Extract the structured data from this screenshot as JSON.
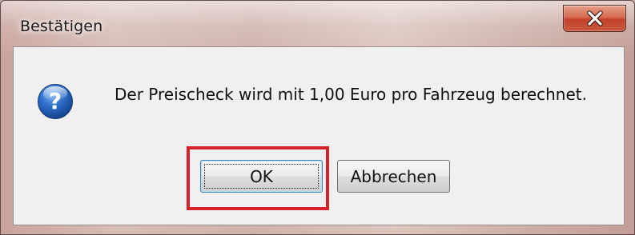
{
  "window": {
    "title": "Bestätigen",
    "close_icon": "close-icon"
  },
  "dialog": {
    "icon": "question-icon",
    "message": "Der Preischeck wird mit 1,00 Euro pro Fahrzeug berechnet."
  },
  "buttons": {
    "ok_label": "OK",
    "cancel_label": "Abbrechen"
  },
  "annotation": {
    "highlight_color": "#d6202a",
    "highlights": "ok-button"
  },
  "colors": {
    "close_button": "#c8462e",
    "dialog_background": "#f0f0f0",
    "question_icon_blue": "#1f5fb5"
  }
}
